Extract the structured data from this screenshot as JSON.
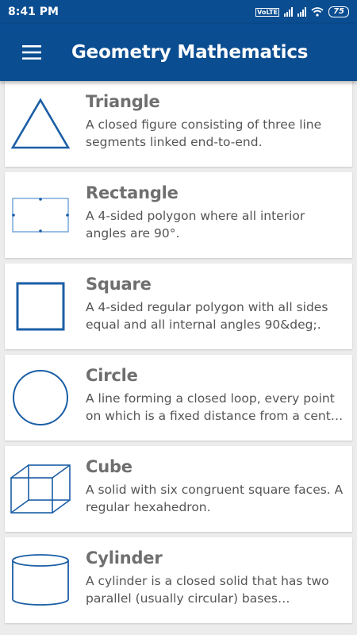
{
  "status": {
    "time": "8:41 PM",
    "battery": "75",
    "volte": "VoLTE"
  },
  "appbar": {
    "title": "Geometry Mathematics"
  },
  "colors": {
    "primary": "#0a4d91",
    "shape_stroke": "#1b5ea6",
    "title": "#6f6f6f",
    "desc": "#555555"
  },
  "shapes": [
    {
      "icon": "triangle-icon",
      "title": "Triangle",
      "desc": "A closed figure consisting of three line segments linked end-to-end."
    },
    {
      "icon": "rectangle-icon",
      "title": "Rectangle",
      "desc": "A 4-sided polygon where all interior angles are 90°."
    },
    {
      "icon": "square-icon",
      "title": "Square",
      "desc": "A 4-sided regular polygon with all sides equal and all internal angles 90&deg;."
    },
    {
      "icon": "circle-icon",
      "title": "Circle",
      "desc": "A line forming a closed loop, every point on which is a fixed distance from a center point."
    },
    {
      "icon": "cube-icon",
      "title": "Cube",
      "desc": "A solid with six congruent square faces. A regular hexahedron."
    },
    {
      "icon": "cylinder-icon",
      "title": "Cylinder",
      "desc": "A cylinder is a closed solid that has two parallel (usually circular) bases connected by a curved surface."
    }
  ]
}
